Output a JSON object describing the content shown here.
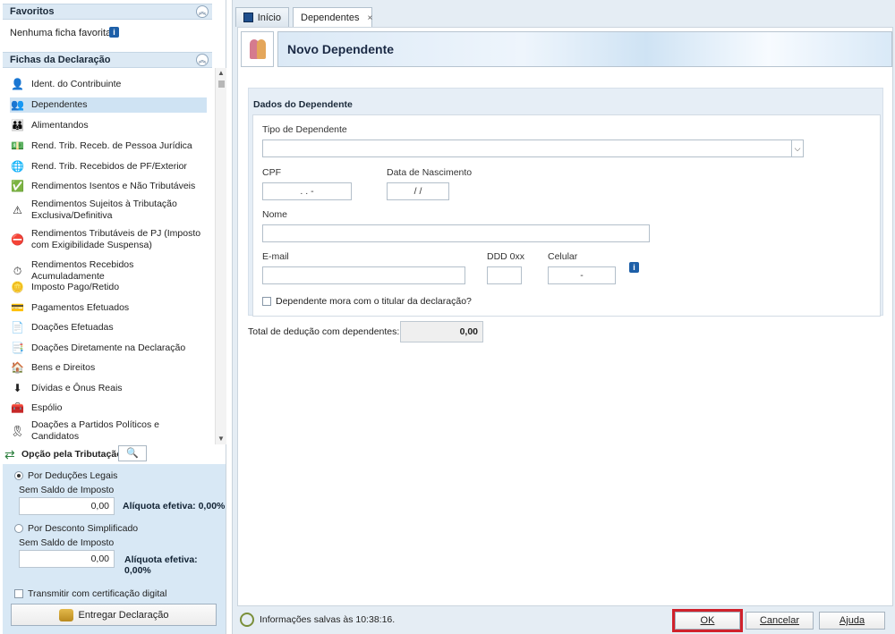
{
  "favoritos": {
    "title": "Favoritos",
    "empty": "Nenhuma ficha favorita"
  },
  "fichas": {
    "title": "Fichas da Declaração",
    "items": [
      {
        "label": "Ident. do Contribuinte",
        "icon": "person-icon"
      },
      {
        "label": "Dependentes",
        "icon": "dependents-icon",
        "selected": true
      },
      {
        "label": "Alimentandos",
        "icon": "alimentandos-icon"
      },
      {
        "label": "Rend. Trib. Receb. de Pessoa Jurídica",
        "icon": "money-in-icon"
      },
      {
        "label": "Rend. Trib. Recebidos de PF/Exterior",
        "icon": "money-in-globe-icon"
      },
      {
        "label": "Rendimentos Isentos e Não Tributáveis",
        "icon": "check-doc-icon"
      },
      {
        "label": "Rendimentos Sujeitos à Tributação Exclusiva/Definitiva",
        "icon": "warning-doc-icon"
      },
      {
        "label": "Rendimentos Tributáveis de PJ (Imposto com Exigibilidade Suspensa)",
        "icon": "suspended-icon"
      },
      {
        "label": "Rendimentos Recebidos Acumuladamente",
        "icon": "clock-money-icon"
      },
      {
        "label": "Imposto Pago/Retido",
        "icon": "coin-hand-icon"
      },
      {
        "label": "Pagamentos Efetuados",
        "icon": "card-icon"
      },
      {
        "label": "Doações Efetuadas",
        "icon": "donation-icon"
      },
      {
        "label": "Doações Diretamente na Declaração",
        "icon": "donation-direct-icon"
      },
      {
        "label": "Bens e Direitos",
        "icon": "assets-icon"
      },
      {
        "label": "Dívidas e Ônus Reais",
        "icon": "debt-arrow-icon"
      },
      {
        "label": "Espólio",
        "icon": "chest-icon"
      },
      {
        "label": "Doações a Partidos Políticos e Candidatos",
        "icon": "party-icon"
      }
    ]
  },
  "tributacao": {
    "label": "Opção pela Tributação:",
    "deducoes": {
      "label": "Por Deduções Legais",
      "selected": true,
      "sub": "Sem Saldo de Imposto",
      "value": "0,00",
      "aliquota": "Alíquota efetiva: 0,00%"
    },
    "simplificado": {
      "label": "Por Desconto Simplificado",
      "selected": false,
      "sub": "Sem Saldo de Imposto",
      "value": "0,00",
      "aliquota": "Alíquota efetiva: 0,00%"
    },
    "transmitir": "Transmitir com certificação digital",
    "entregar": "Entregar Declaração"
  },
  "tabs": [
    {
      "label": "Início"
    },
    {
      "label": "Dependentes",
      "close": "×"
    }
  ],
  "page": {
    "title": "Novo Dependente"
  },
  "form": {
    "section_title": "Dados do Dependente",
    "tipo_label": "Tipo de Dependente",
    "tipo_value": "",
    "cpf_label": "CPF",
    "cpf_value": ". . -",
    "nasc_label": "Data de Nascimento",
    "nasc_value": "/ /",
    "nome_label": "Nome",
    "nome_value": "",
    "email_label": "E-mail",
    "email_value": "",
    "ddd_label": "DDD 0xx",
    "ddd_value": "",
    "celular_label": "Celular",
    "celular_value": "-",
    "mora_label": "Dependente mora com o titular da declaração?"
  },
  "total": {
    "label": "Total de dedução com dependentes:",
    "value": "0,00"
  },
  "status": {
    "text": "Informações salvas às 10:38:16."
  },
  "buttons": {
    "ok": "OK",
    "cancelar": "Cancelar",
    "ajuda": "Ajuda"
  },
  "colors": {
    "highlight_outline": "#d0212b",
    "section_header": "#dce9f4",
    "selected_row": "#cfe3f3"
  }
}
